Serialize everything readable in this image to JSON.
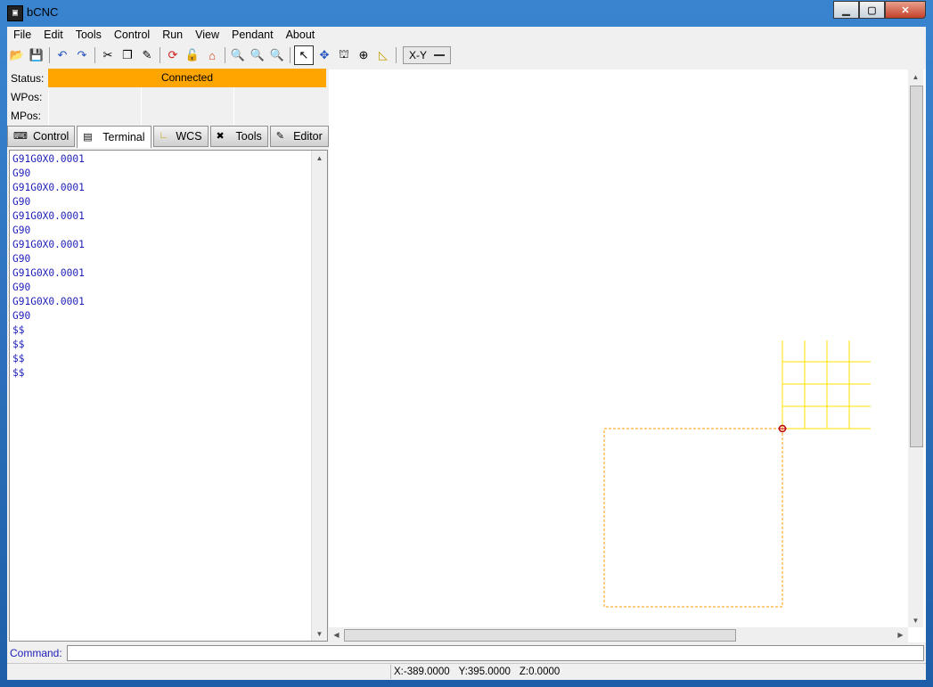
{
  "window": {
    "title": "bCNC"
  },
  "menu": [
    "File",
    "Edit",
    "Tools",
    "Control",
    "Run",
    "View",
    "Pendant",
    "About"
  ],
  "toolbar": {
    "icons": [
      "open-file-icon",
      "save-icon",
      "undo-icon",
      "redo-icon",
      "cut-icon",
      "copy-icon",
      "paste-icon",
      "reset-icon",
      "unlock-icon",
      "home-icon",
      "zoom-in-icon",
      "zoom-out-icon",
      "zoom-fit-icon",
      "select-arrow-icon",
      "pan-icon",
      "gantry-icon",
      "target-icon",
      "ruler-icon"
    ],
    "view_select": "X-Y"
  },
  "status": {
    "label": "Status:",
    "value": "Connected",
    "color": "#ffa500"
  },
  "wpos": {
    "label": "WPos:"
  },
  "mpos": {
    "label": "MPos:"
  },
  "tabs": [
    {
      "label": "Control",
      "icon": "control-icon"
    },
    {
      "label": "Terminal",
      "icon": "terminal-icon"
    },
    {
      "label": "WCS",
      "icon": "wcs-icon"
    },
    {
      "label": "Tools",
      "icon": "tools-icon"
    },
    {
      "label": "Editor",
      "icon": "editor-icon"
    }
  ],
  "terminal": {
    "lines": [
      "G91G0X0.0001",
      "G90",
      "G91G0X0.0001",
      "G90",
      "G91G0X0.0001",
      "G90",
      "G91G0X0.0001",
      "G90",
      "G91G0X0.0001",
      "G90",
      "G91G0X0.0001",
      "G90",
      "$$",
      "$$",
      "$$",
      "$$"
    ]
  },
  "command": {
    "label": "Command:"
  },
  "statusbar": {
    "x": "X:-389.0000",
    "y": "Y:395.0000",
    "z": "Z:0.0000"
  }
}
